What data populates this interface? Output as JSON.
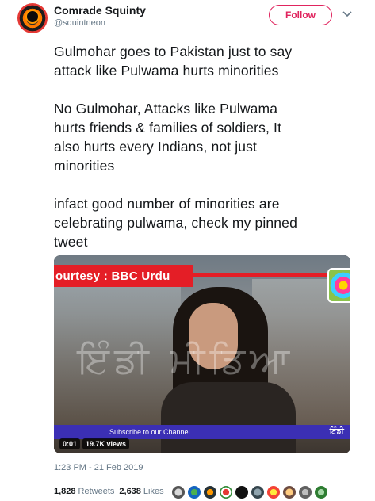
{
  "tweet": {
    "author_name": "Comrade Squinty",
    "author_handle": "@squintneon",
    "follow_label": "Follow",
    "paragraphs": [
      "Gulmohar goes to Pakistan just to say\nattack like Pulwama hurts minorities",
      "No Gulmohar, Attacks like Pulwama\nhurts friends & families of soldiers, It\nalso hurts every Indians, not just\nminorities",
      "infact good number of minorities are\ncelebrating pulwama, check my pinned\ntweet"
    ],
    "timestamp": "1:23 PM - 21 Feb 2019"
  },
  "video": {
    "banner_text": "ourtesy : BBC Urdu",
    "subscribe_text": "Subscribe to our Channel",
    "sub_right_text": "ਇੰਡੀ",
    "watermark_text": "ਇੰਡੀ ਮੀਡਿਆ",
    "elapsed": "0:01",
    "views": "19.7K views"
  },
  "stats": {
    "retweets_count": "1,828",
    "retweets_label": "Retweets",
    "likes_count": "2,638",
    "likes_label": "Likes"
  },
  "colors": {
    "follow_accent": "#e0245e",
    "bbc_red": "#e41e26",
    "subscribe_bar": "#3b2fb4",
    "secondary_text": "#657786"
  },
  "icons": {
    "more": "chevron-down-icon"
  }
}
